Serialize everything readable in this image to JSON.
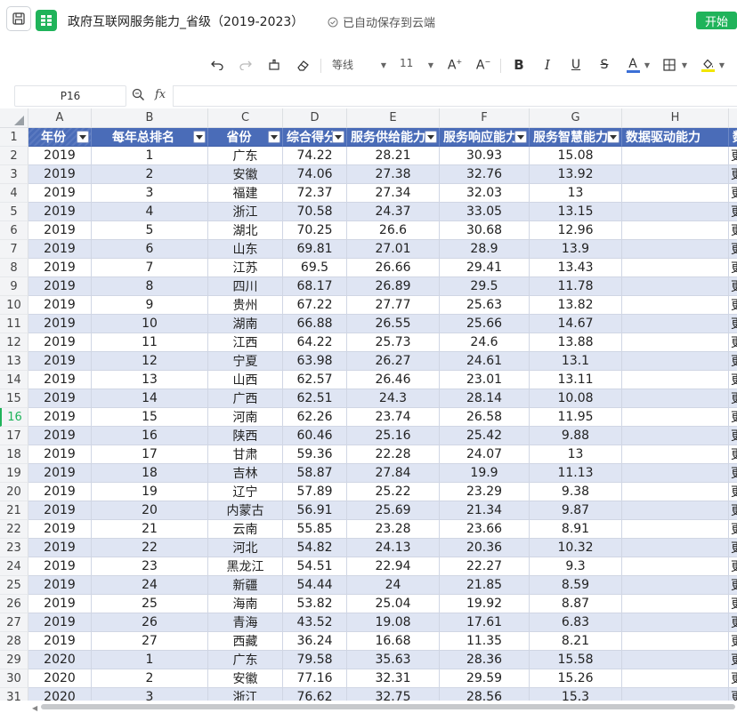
{
  "app": {
    "title": "政府互联网服务能力_省级（2019-2023）",
    "save_status": "已自动保存到云端",
    "start_label": "开始"
  },
  "toolbar": {
    "font_name": "等线",
    "font_size": "11",
    "icons": [
      "undo-icon",
      "redo-icon",
      "format-painter-icon",
      "eraser-icon",
      "font-family-select",
      "font-size-select",
      "increase-font-icon",
      "decrease-font-icon",
      "bold-icon",
      "italic-icon",
      "underline-icon",
      "strikethrough-icon",
      "font-color-icon",
      "border-icon",
      "fill-color-icon"
    ],
    "bold": "B",
    "italic": "I",
    "underline": "U",
    "strike": "S",
    "font_color_letter": "A",
    "font_color": "#3b6fd6",
    "fill_color": "#f2e600"
  },
  "formula_bar": {
    "cell_ref": "P16",
    "fx_label": "fx",
    "value": ""
  },
  "grid": {
    "columns": [
      "A",
      "B",
      "C",
      "D",
      "E",
      "F",
      "G",
      "H"
    ],
    "active_row": "16",
    "header_row_number": "1",
    "headers": [
      "年份",
      "每年总排名",
      "省份",
      "综合得分",
      "服务供给能力",
      "服务响应能力",
      "服务智慧能力",
      "数据驱动能力",
      "数"
    ],
    "rows": [
      [
        "2",
        "2019",
        "1",
        "广东",
        "74.22",
        "28.21",
        "30.93",
        "15.08",
        "",
        "更"
      ],
      [
        "3",
        "2019",
        "2",
        "安徽",
        "74.06",
        "27.38",
        "32.76",
        "13.92",
        "",
        "更"
      ],
      [
        "4",
        "2019",
        "3",
        "福建",
        "72.37",
        "27.34",
        "32.03",
        "13",
        "",
        "更"
      ],
      [
        "5",
        "2019",
        "4",
        "浙江",
        "70.58",
        "24.37",
        "33.05",
        "13.15",
        "",
        "更"
      ],
      [
        "6",
        "2019",
        "5",
        "湖北",
        "70.25",
        "26.6",
        "30.68",
        "12.96",
        "",
        "更"
      ],
      [
        "7",
        "2019",
        "6",
        "山东",
        "69.81",
        "27.01",
        "28.9",
        "13.9",
        "",
        "更"
      ],
      [
        "8",
        "2019",
        "7",
        "江苏",
        "69.5",
        "26.66",
        "29.41",
        "13.43",
        "",
        "更"
      ],
      [
        "9",
        "2019",
        "8",
        "四川",
        "68.17",
        "26.89",
        "29.5",
        "11.78",
        "",
        "更"
      ],
      [
        "10",
        "2019",
        "9",
        "贵州",
        "67.22",
        "27.77",
        "25.63",
        "13.82",
        "",
        "更"
      ],
      [
        "11",
        "2019",
        "10",
        "湖南",
        "66.88",
        "26.55",
        "25.66",
        "14.67",
        "",
        "更"
      ],
      [
        "12",
        "2019",
        "11",
        "江西",
        "64.22",
        "25.73",
        "24.6",
        "13.88",
        "",
        "更"
      ],
      [
        "13",
        "2019",
        "12",
        "宁夏",
        "63.98",
        "26.27",
        "24.61",
        "13.1",
        "",
        "更"
      ],
      [
        "14",
        "2019",
        "13",
        "山西",
        "62.57",
        "26.46",
        "23.01",
        "13.11",
        "",
        "更"
      ],
      [
        "15",
        "2019",
        "14",
        "广西",
        "62.51",
        "24.3",
        "28.14",
        "10.08",
        "",
        "更"
      ],
      [
        "16",
        "2019",
        "15",
        "河南",
        "62.26",
        "23.74",
        "26.58",
        "11.95",
        "",
        "更"
      ],
      [
        "17",
        "2019",
        "16",
        "陕西",
        "60.46",
        "25.16",
        "25.42",
        "9.88",
        "",
        "更"
      ],
      [
        "18",
        "2019",
        "17",
        "甘肃",
        "59.36",
        "22.28",
        "24.07",
        "13",
        "",
        "更"
      ],
      [
        "19",
        "2019",
        "18",
        "吉林",
        "58.87",
        "27.84",
        "19.9",
        "11.13",
        "",
        "更"
      ],
      [
        "20",
        "2019",
        "19",
        "辽宁",
        "57.89",
        "25.22",
        "23.29",
        "9.38",
        "",
        "更"
      ],
      [
        "21",
        "2019",
        "20",
        "内蒙古",
        "56.91",
        "25.69",
        "21.34",
        "9.87",
        "",
        "更"
      ],
      [
        "22",
        "2019",
        "21",
        "云南",
        "55.85",
        "23.28",
        "23.66",
        "8.91",
        "",
        "更"
      ],
      [
        "23",
        "2019",
        "22",
        "河北",
        "54.82",
        "24.13",
        "20.36",
        "10.32",
        "",
        "更"
      ],
      [
        "24",
        "2019",
        "23",
        "黑龙江",
        "54.51",
        "22.94",
        "22.27",
        "9.3",
        "",
        "更"
      ],
      [
        "25",
        "2019",
        "24",
        "新疆",
        "54.44",
        "24",
        "21.85",
        "8.59",
        "",
        "更"
      ],
      [
        "26",
        "2019",
        "25",
        "海南",
        "53.82",
        "25.04",
        "19.92",
        "8.87",
        "",
        "更"
      ],
      [
        "27",
        "2019",
        "26",
        "青海",
        "43.52",
        "19.08",
        "17.61",
        "6.83",
        "",
        "更"
      ],
      [
        "28",
        "2019",
        "27",
        "西藏",
        "36.24",
        "16.68",
        "11.35",
        "8.21",
        "",
        "更"
      ],
      [
        "29",
        "2020",
        "1",
        "广东",
        "79.58",
        "35.63",
        "28.36",
        "15.58",
        "",
        "更"
      ],
      [
        "30",
        "2020",
        "2",
        "安徽",
        "77.16",
        "32.31",
        "29.59",
        "15.26",
        "",
        "更"
      ],
      [
        "31",
        "2020",
        "3",
        "浙江",
        "76.62",
        "32.75",
        "28.56",
        "15.3",
        "",
        "更"
      ]
    ]
  }
}
